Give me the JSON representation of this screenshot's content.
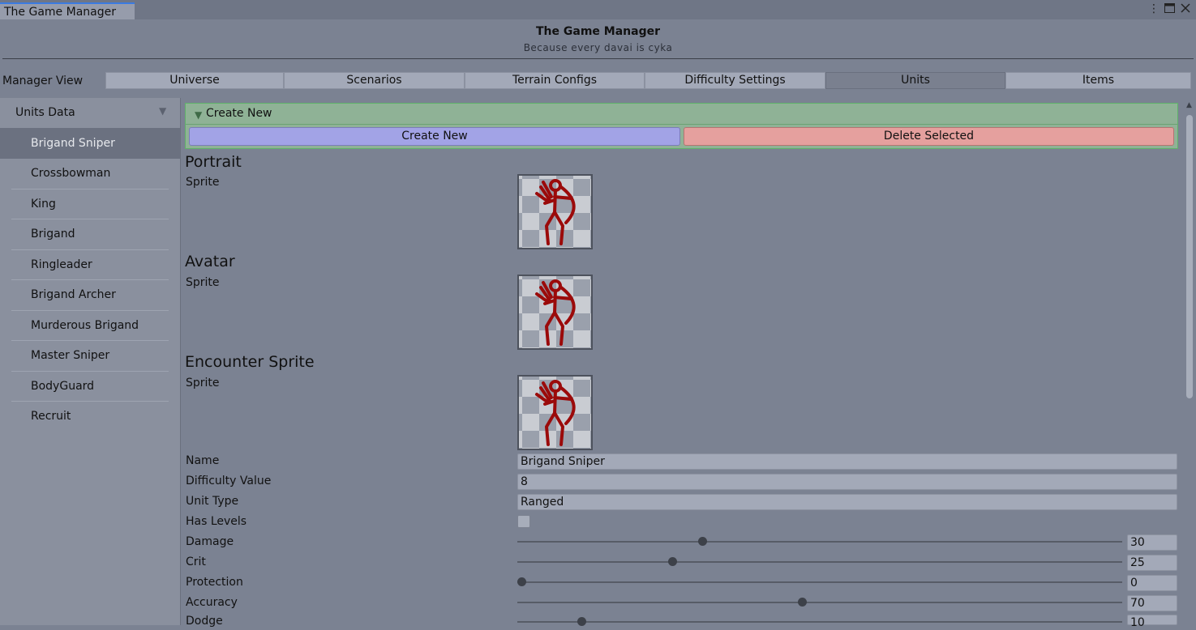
{
  "window": {
    "tab_title": "The Game Manager",
    "menu_icon": "more-vert-icon",
    "maximize_icon": "maximize-icon",
    "close_icon": "close-icon"
  },
  "header": {
    "title": "The Game Manager",
    "subtitle": "Because every davai is cyka"
  },
  "manager_view": {
    "label": "Manager View",
    "tabs": [
      {
        "label": "Universe",
        "active": false
      },
      {
        "label": "Scenarios",
        "active": false
      },
      {
        "label": "Terrain Configs",
        "active": false
      },
      {
        "label": "Difficulty Settings",
        "active": false
      },
      {
        "label": "Units",
        "active": true
      },
      {
        "label": "Items",
        "active": false
      }
    ]
  },
  "sidebar": {
    "header": "Units Data",
    "selected_index": 0,
    "items": [
      {
        "label": "Brigand Sniper"
      },
      {
        "label": "Crossbowman"
      },
      {
        "label": "King"
      },
      {
        "label": "Brigand"
      },
      {
        "label": "Ringleader"
      },
      {
        "label": "Brigand Archer"
      },
      {
        "label": "Murderous Brigand"
      },
      {
        "label": "Master Sniper"
      },
      {
        "label": "BodyGuard"
      },
      {
        "label": "Recruit"
      }
    ]
  },
  "create_panel": {
    "foldout_label": "Create New",
    "create_button": "Create New",
    "delete_button": "Delete Selected"
  },
  "sections": {
    "portrait": {
      "title": "Portrait",
      "field_label": "Sprite"
    },
    "avatar": {
      "title": "Avatar",
      "field_label": "Sprite"
    },
    "encounter": {
      "title": "Encounter Sprite",
      "field_label": "Sprite"
    }
  },
  "fields": {
    "name": {
      "label": "Name",
      "value": "Brigand Sniper"
    },
    "difficulty": {
      "label": "Difficulty Value",
      "value": "8"
    },
    "unit_type": {
      "label": "Unit Type",
      "value": "Ranged"
    },
    "has_levels": {
      "label": "Has Levels",
      "checked": false
    }
  },
  "sliders": [
    {
      "label": "Damage",
      "value": "30",
      "fraction": 0.3
    },
    {
      "label": "Crit",
      "value": "25",
      "fraction": 0.25
    },
    {
      "label": "Protection",
      "value": "0",
      "fraction": 0.0
    },
    {
      "label": "Accuracy",
      "value": "70",
      "fraction": 0.465
    },
    {
      "label": "Dodge",
      "value": "10",
      "fraction": 0.1
    }
  ],
  "colors": {
    "create_button": "#a2a3e6",
    "delete_button": "#e5a09e",
    "create_panel": "#8fb296",
    "sprite_red": "#9b0a0a"
  }
}
